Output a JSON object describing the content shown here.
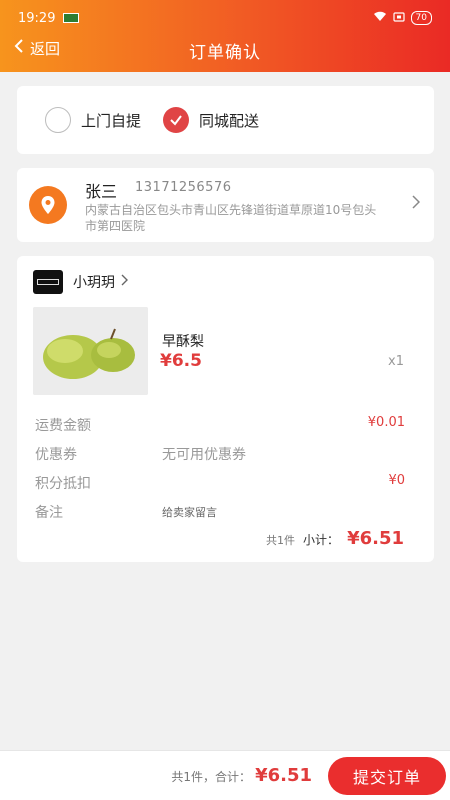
{
  "status_bar": {
    "time": "19:29",
    "battery": "70"
  },
  "nav": {
    "back_label": "返回",
    "title": "订单确认"
  },
  "delivery": {
    "options": [
      {
        "label": "上门自提",
        "selected": false
      },
      {
        "label": "同城配送",
        "selected": true
      }
    ]
  },
  "address": {
    "name": "张三",
    "phone": "13171256576",
    "detail": "内蒙古自治区包头市青山区先锋道街道草原道10号包头市第四医院"
  },
  "shop": {
    "name": "小玥玥"
  },
  "product": {
    "name": "早酥梨",
    "price": "¥6.5",
    "quantity": "x1"
  },
  "fees": {
    "shipping_label": "运费金额",
    "shipping_value": "¥0.01",
    "coupon_label": "优惠券",
    "coupon_value": "无可用优惠券",
    "points_label": "积分抵扣",
    "points_value": "¥0",
    "note_label": "备注",
    "note_placeholder": "给卖家留言"
  },
  "subtotal": {
    "count_text": "共1件",
    "label": "小计：",
    "amount": "¥6.51"
  },
  "footer": {
    "count_text": "共1件，合计：",
    "amount": "¥6.51",
    "submit_label": "提交订单"
  },
  "colors": {
    "accent": "#e03c3c",
    "header_start": "#f7941d",
    "header_end": "#ea2a25",
    "pin": "#f47920"
  }
}
